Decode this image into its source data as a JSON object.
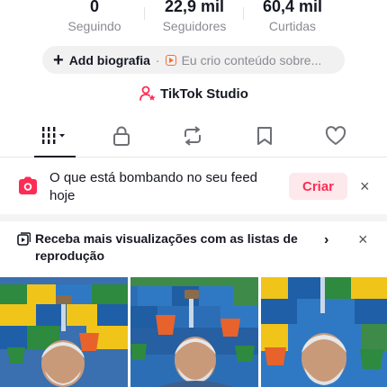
{
  "stats": [
    {
      "value": "0",
      "label": "Seguindo"
    },
    {
      "value": "22,9 mil",
      "label": "Seguidores"
    },
    {
      "value": "60,4 mil",
      "label": "Curtidas"
    }
  ],
  "bio": {
    "add_label": "Add biografia",
    "separator": "·",
    "snippet": "Eu crio conteúdo sobre..."
  },
  "studio": {
    "label": "TikTok Studio"
  },
  "tabs": [
    {
      "icon": "grid-icon",
      "active": true
    },
    {
      "icon": "lock-icon",
      "active": false
    },
    {
      "icon": "repost-icon",
      "active": false
    },
    {
      "icon": "bookmark-icon",
      "active": false
    },
    {
      "icon": "heart-icon",
      "active": false
    }
  ],
  "feed_prompt": {
    "text": "O que está bombando no seu feed hoje",
    "button": "Criar",
    "close": "×"
  },
  "playlist_prompt": {
    "text": "Receba mais visualizações com as listas de reprodução",
    "chevron": "›",
    "close": "×"
  },
  "colors": {
    "accent": "#fe2c55",
    "muted": "#8a8b91",
    "text": "#161823"
  }
}
